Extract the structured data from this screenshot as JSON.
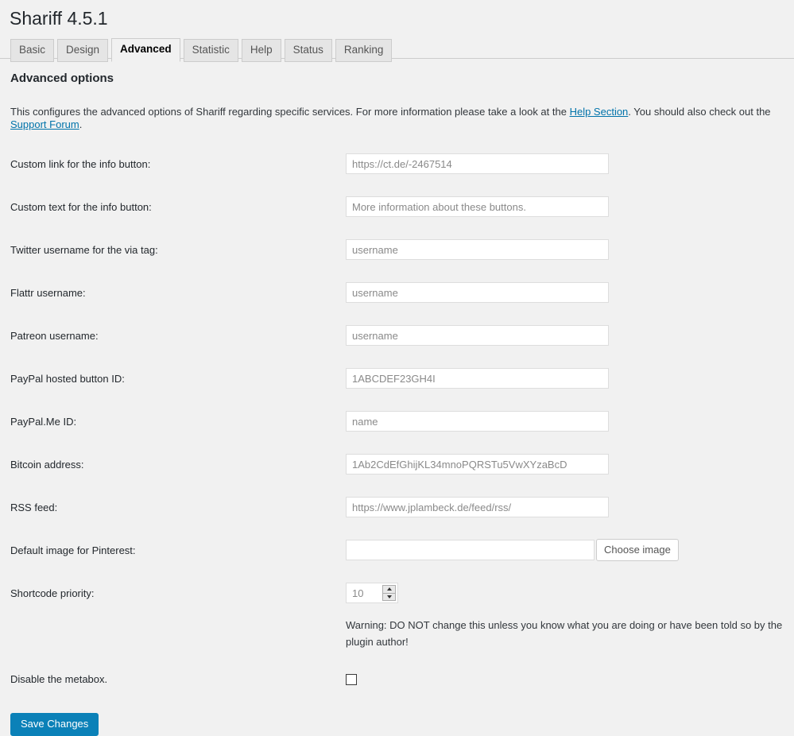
{
  "header": {
    "title": "Shariff 4.5.1"
  },
  "tabs": [
    {
      "label": "Basic",
      "active": false
    },
    {
      "label": "Design",
      "active": false
    },
    {
      "label": "Advanced",
      "active": true
    },
    {
      "label": "Statistic",
      "active": false
    },
    {
      "label": "Help",
      "active": false
    },
    {
      "label": "Status",
      "active": false
    },
    {
      "label": "Ranking",
      "active": false
    }
  ],
  "section": {
    "title": "Advanced options",
    "desc_part1": "This configures the advanced options of Shariff regarding specific services. For more information please take a look at the ",
    "link_help": "Help Section",
    "desc_part2": ". You should also check out the ",
    "link_support": "Support Forum",
    "desc_part3": "."
  },
  "fields": {
    "custom_link": {
      "label": "Custom link for the info button:",
      "value": "",
      "placeholder": "https://ct.de/-2467514"
    },
    "custom_text": {
      "label": "Custom text for the info button:",
      "value": "",
      "placeholder": "More information about these buttons."
    },
    "twitter": {
      "label": "Twitter username for the via tag:",
      "value": "",
      "placeholder": "username"
    },
    "flattr": {
      "label": "Flattr username:",
      "value": "",
      "placeholder": "username"
    },
    "patreon": {
      "label": "Patreon username:",
      "value": "",
      "placeholder": "username"
    },
    "paypal_button": {
      "label": "PayPal hosted button ID:",
      "value": "",
      "placeholder": "1ABCDEF23GH4I"
    },
    "paypalme": {
      "label": "PayPal.Me ID:",
      "value": "",
      "placeholder": "name"
    },
    "bitcoin": {
      "label": "Bitcoin address:",
      "value": "",
      "placeholder": "1Ab2CdEfGhijKL34mnoPQRSTu5VwXYzaBcD"
    },
    "rss": {
      "label": "RSS feed:",
      "value": "",
      "placeholder": "https://www.jplambeck.de/feed/rss/"
    },
    "pinterest": {
      "label": "Default image for Pinterest:",
      "value": "",
      "placeholder": "",
      "button_label": "Choose image"
    },
    "shortcode_priority": {
      "label": "Shortcode priority:",
      "value": "10",
      "warning": "Warning: DO NOT change this unless you know what you are doing or have been told so by the plugin author!"
    },
    "disable_metabox": {
      "label": "Disable the metabox.",
      "checked": false
    }
  },
  "submit": {
    "label": "Save Changes"
  },
  "colors": {
    "accent": "#0b81b8",
    "link": "#0073aa",
    "background": "#f1f1f1"
  }
}
